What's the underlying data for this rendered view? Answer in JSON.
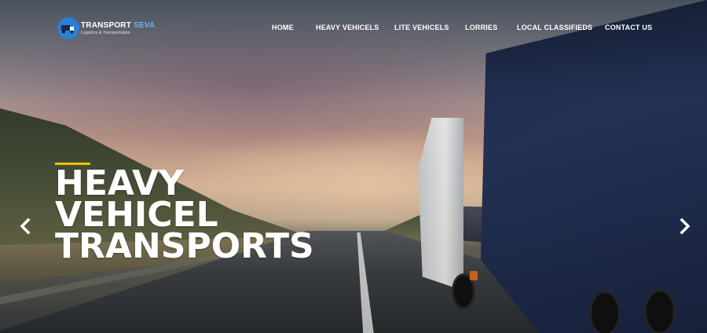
{
  "brand": {
    "name_part1": "TRANSPORT ",
    "name_part2": "SEVA",
    "tagline": "Logistics & Transportation",
    "icon": "truck-logo-icon",
    "accent_color": "#2a7fd4"
  },
  "nav": {
    "items": [
      {
        "label": "HOME"
      },
      {
        "label": "HEAVY VEHICELS"
      },
      {
        "label": "LITE VEHICELS"
      },
      {
        "label": "LORRIES"
      },
      {
        "label": "LOCAL CLASSIFIEDS"
      },
      {
        "label": "CONTACT US"
      }
    ]
  },
  "hero": {
    "headline_lines": [
      "HEAVY",
      "VEHICEL",
      "TRANSPORTS"
    ],
    "accent_color": "#f2c200",
    "prev_icon": "chevron-left-icon",
    "next_icon": "chevron-right-icon"
  }
}
